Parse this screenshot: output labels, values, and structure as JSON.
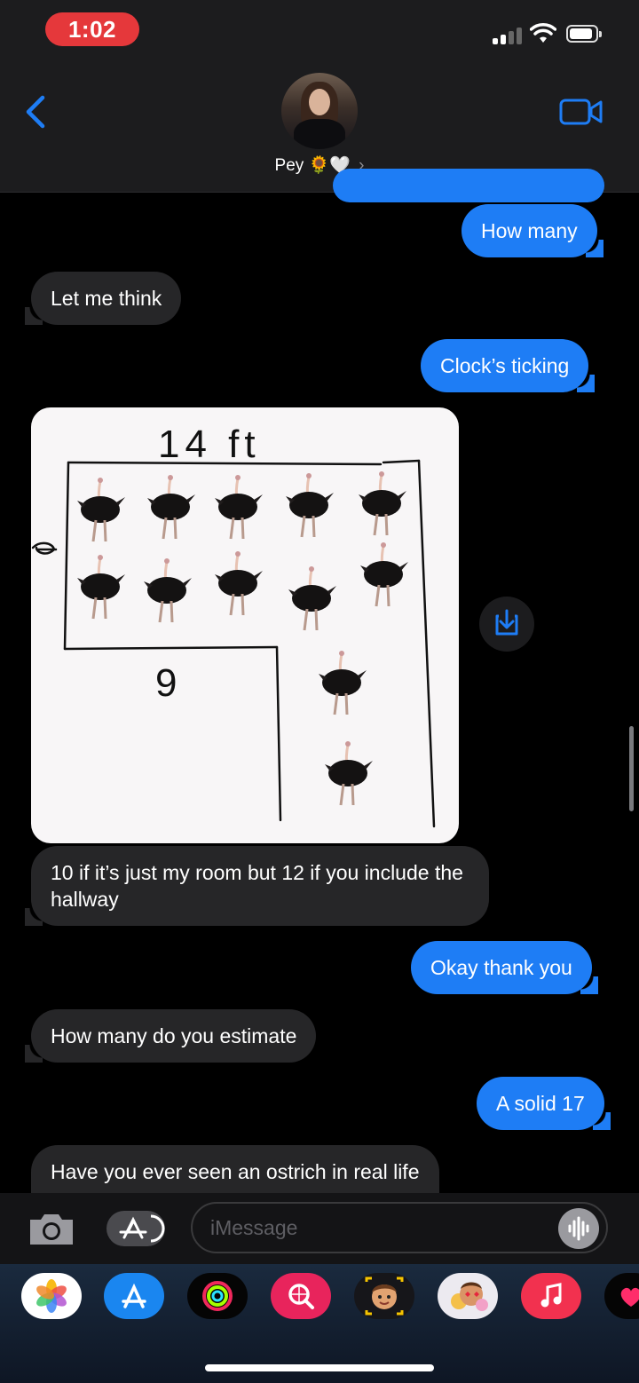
{
  "status_bar": {
    "time": "1:02"
  },
  "header": {
    "contact_name": "Pey",
    "contact_emoji": "🌻🤍",
    "chevron": "›"
  },
  "messages": [
    {
      "from": "me",
      "text": "How many"
    },
    {
      "from": "them",
      "text": "Let me think"
    },
    {
      "from": "me",
      "text": "Clock’s ticking"
    },
    {
      "from": "them",
      "type": "image",
      "drawing_labels": {
        "top": "14 ft",
        "left": "6",
        "middle": "9"
      }
    },
    {
      "from": "them",
      "text": "10 if it’s just my room but 12 if you include the hallway"
    },
    {
      "from": "me",
      "text": "Okay thank you"
    },
    {
      "from": "them",
      "text": "How many do you estimate"
    },
    {
      "from": "me",
      "text": "A solid 17"
    },
    {
      "from": "them",
      "text": "Have you ever seen an ostrich in real life"
    }
  ],
  "composer": {
    "placeholder": "iMessage"
  },
  "app_tray": [
    "photos-icon",
    "app-store-icon",
    "activity-icon",
    "search-images-icon",
    "memoji-icon",
    "memoji-stickers-icon",
    "music-icon",
    "digital-touch-icon"
  ]
}
